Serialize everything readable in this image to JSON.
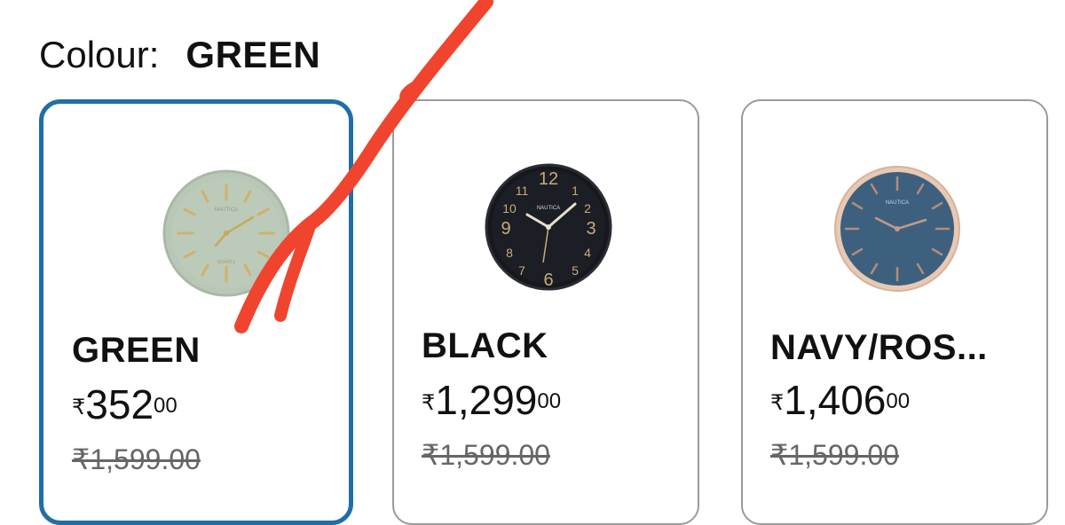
{
  "colour": {
    "label": "Colour:",
    "selected": "GREEN"
  },
  "variants": [
    {
      "name": "GREEN",
      "currency": "₹",
      "price_whole": "352",
      "price_fraction": "00",
      "mrp": "₹1,599.00",
      "selected": true,
      "clock_brand": "NAUTICA",
      "clock_sub": "QUARTZ"
    },
    {
      "name": "BLACK",
      "currency": "₹",
      "price_whole": "1,299",
      "price_fraction": "00",
      "mrp": "₹1,599.00",
      "selected": false,
      "clock_brand": "NAUTICA"
    },
    {
      "name": "NAVY/ROS...",
      "currency": "₹",
      "price_whole": "1,406",
      "price_fraction": "00",
      "mrp": "₹1,599.00",
      "selected": false,
      "clock_brand": "NAUTICA"
    }
  ],
  "colors": {
    "selected_border": "#1f6ea8",
    "annotation_stroke": "#f0442e"
  }
}
